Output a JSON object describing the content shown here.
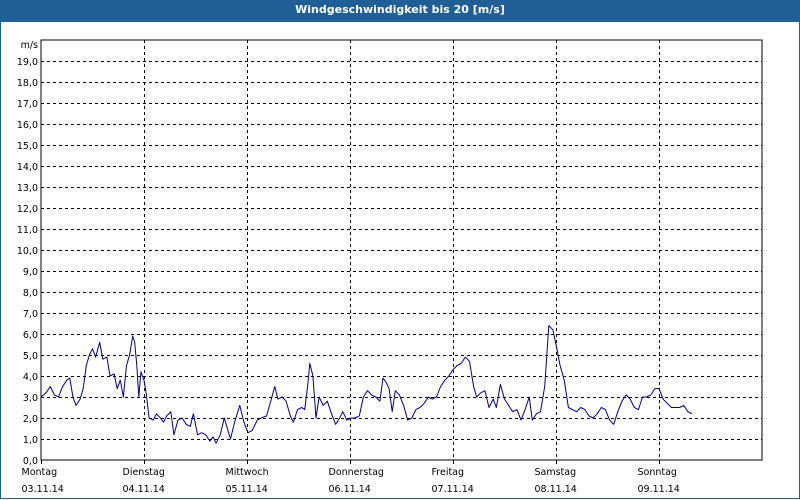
{
  "window": {
    "title": "Windgeschwindigkeit bis 20 [m/s]"
  },
  "chart_data": {
    "type": "line",
    "title": "Windgeschwindigkeit bis 20 [m/s]",
    "ylabel": "m/s",
    "ylim": [
      0,
      20
    ],
    "grid": true,
    "line_color": "#00008b",
    "grid_color": "#000000",
    "y_ticks": [
      "0,0",
      "1,0",
      "2,0",
      "3,0",
      "4,0",
      "5,0",
      "6,0",
      "7,0",
      "8,0",
      "9,0",
      "10,0",
      "11,0",
      "12,0",
      "13,0",
      "14,0",
      "15,0",
      "16,0",
      "17,0",
      "18,0",
      "19,0"
    ],
    "x_ticks": [
      {
        "day": "Montag",
        "date": "03.11.14"
      },
      {
        "day": "Dienstag",
        "date": "04.11.14"
      },
      {
        "day": "Mittwoch",
        "date": "05.11.14"
      },
      {
        "day": "Donnerstag",
        "date": "06.11.14"
      },
      {
        "day": "Freitag",
        "date": "07.11.14"
      },
      {
        "day": "Samstag",
        "date": "08.11.14"
      },
      {
        "day": "Sonntag",
        "date": "09.11.14"
      }
    ],
    "x_range_days": [
      0,
      7.0
    ],
    "series": [
      {
        "values": [
          [
            0.0,
            3.0
          ],
          [
            0.05,
            3.2
          ],
          [
            0.09,
            3.5
          ],
          [
            0.13,
            3.1
          ],
          [
            0.17,
            3.0
          ],
          [
            0.21,
            3.5
          ],
          [
            0.25,
            3.8
          ],
          [
            0.28,
            3.9
          ],
          [
            0.31,
            3.0
          ],
          [
            0.34,
            2.6
          ],
          [
            0.38,
            2.9
          ],
          [
            0.41,
            3.4
          ],
          [
            0.44,
            4.5
          ],
          [
            0.47,
            5.0
          ],
          [
            0.5,
            5.3
          ],
          [
            0.53,
            4.9
          ],
          [
            0.57,
            5.6
          ],
          [
            0.6,
            4.8
          ],
          [
            0.64,
            4.9
          ],
          [
            0.67,
            4.0
          ],
          [
            0.71,
            4.1
          ],
          [
            0.74,
            3.4
          ],
          [
            0.77,
            3.8
          ],
          [
            0.8,
            3.0
          ],
          [
            0.83,
            4.5
          ],
          [
            0.86,
            5.0
          ],
          [
            0.89,
            5.9
          ],
          [
            0.91,
            5.6
          ],
          [
            0.93,
            4.5
          ],
          [
            0.95,
            3.0
          ],
          [
            0.97,
            4.2
          ],
          [
            1.0,
            3.8
          ],
          [
            1.02,
            3.2
          ],
          [
            1.05,
            2.0
          ],
          [
            1.09,
            1.9
          ],
          [
            1.12,
            2.2
          ],
          [
            1.16,
            2.0
          ],
          [
            1.19,
            1.8
          ],
          [
            1.22,
            2.1
          ],
          [
            1.26,
            2.3
          ],
          [
            1.29,
            1.2
          ],
          [
            1.33,
            1.9
          ],
          [
            1.37,
            2.0
          ],
          [
            1.41,
            1.7
          ],
          [
            1.45,
            1.6
          ],
          [
            1.48,
            2.2
          ],
          [
            1.52,
            1.2
          ],
          [
            1.56,
            1.3
          ],
          [
            1.6,
            1.2
          ],
          [
            1.64,
            0.9
          ],
          [
            1.67,
            1.1
          ],
          [
            1.7,
            0.8
          ],
          [
            1.74,
            1.2
          ],
          [
            1.78,
            2.0
          ],
          [
            1.81,
            1.5
          ],
          [
            1.84,
            1.0
          ],
          [
            1.88,
            1.8
          ],
          [
            1.93,
            2.6
          ],
          [
            1.97,
            1.8
          ],
          [
            2.01,
            1.3
          ],
          [
            2.05,
            1.4
          ],
          [
            2.1,
            1.9
          ],
          [
            2.14,
            2.0
          ],
          [
            2.19,
            2.1
          ],
          [
            2.23,
            2.8
          ],
          [
            2.27,
            3.5
          ],
          [
            2.3,
            2.9
          ],
          [
            2.34,
            3.0
          ],
          [
            2.38,
            2.8
          ],
          [
            2.42,
            2.1
          ],
          [
            2.45,
            1.8
          ],
          [
            2.49,
            2.4
          ],
          [
            2.53,
            2.5
          ],
          [
            2.56,
            2.4
          ],
          [
            2.59,
            3.6
          ],
          [
            2.61,
            4.6
          ],
          [
            2.64,
            4.0
          ],
          [
            2.67,
            2.0
          ],
          [
            2.7,
            3.0
          ],
          [
            2.74,
            2.6
          ],
          [
            2.78,
            2.8
          ],
          [
            2.82,
            2.2
          ],
          [
            2.86,
            1.7
          ],
          [
            2.9,
            2.0
          ],
          [
            2.93,
            2.3
          ],
          [
            2.97,
            1.9
          ],
          [
            3.01,
            2.0
          ],
          [
            3.05,
            2.0
          ],
          [
            3.09,
            2.1
          ],
          [
            3.13,
            3.0
          ],
          [
            3.17,
            3.3
          ],
          [
            3.21,
            3.1
          ],
          [
            3.25,
            3.0
          ],
          [
            3.29,
            2.8
          ],
          [
            3.32,
            3.9
          ],
          [
            3.35,
            3.7
          ],
          [
            3.38,
            3.4
          ],
          [
            3.41,
            2.3
          ],
          [
            3.44,
            3.3
          ],
          [
            3.48,
            3.1
          ],
          [
            3.52,
            2.6
          ],
          [
            3.56,
            1.9
          ],
          [
            3.6,
            2.0
          ],
          [
            3.64,
            2.4
          ],
          [
            3.68,
            2.5
          ],
          [
            3.72,
            2.7
          ],
          [
            3.76,
            3.0
          ],
          [
            3.8,
            2.9
          ],
          [
            3.84,
            3.0
          ],
          [
            3.88,
            3.5
          ],
          [
            3.92,
            3.8
          ],
          [
            3.96,
            4.0
          ],
          [
            4.0,
            4.3
          ],
          [
            4.04,
            4.5
          ],
          [
            4.08,
            4.6
          ],
          [
            4.12,
            4.9
          ],
          [
            4.16,
            4.7
          ],
          [
            4.2,
            3.5
          ],
          [
            4.23,
            3.0
          ],
          [
            4.27,
            3.2
          ],
          [
            4.31,
            3.3
          ],
          [
            4.35,
            2.5
          ],
          [
            4.39,
            2.9
          ],
          [
            4.42,
            2.5
          ],
          [
            4.46,
            3.6
          ],
          [
            4.5,
            2.9
          ],
          [
            4.54,
            2.6
          ],
          [
            4.58,
            2.3
          ],
          [
            4.62,
            2.4
          ],
          [
            4.66,
            1.9
          ],
          [
            4.7,
            2.4
          ],
          [
            4.74,
            3.0
          ],
          [
            4.77,
            1.9
          ],
          [
            4.81,
            2.2
          ],
          [
            4.85,
            2.3
          ],
          [
            4.89,
            3.5
          ],
          [
            4.93,
            6.4
          ],
          [
            4.97,
            6.2
          ],
          [
            5.0,
            5.5
          ],
          [
            5.04,
            4.5
          ],
          [
            5.08,
            3.8
          ],
          [
            5.12,
            2.5
          ],
          [
            5.16,
            2.4
          ],
          [
            5.2,
            2.3
          ],
          [
            5.24,
            2.5
          ],
          [
            5.28,
            2.4
          ],
          [
            5.32,
            2.1
          ],
          [
            5.36,
            2.0
          ],
          [
            5.4,
            2.2
          ],
          [
            5.44,
            2.5
          ],
          [
            5.48,
            2.4
          ],
          [
            5.52,
            1.9
          ],
          [
            5.56,
            1.7
          ],
          [
            5.6,
            2.3
          ],
          [
            5.64,
            2.8
          ],
          [
            5.68,
            3.1
          ],
          [
            5.72,
            2.9
          ],
          [
            5.76,
            2.5
          ],
          [
            5.8,
            2.4
          ],
          [
            5.84,
            3.0
          ],
          [
            5.88,
            3.0
          ],
          [
            5.92,
            3.1
          ],
          [
            5.96,
            3.4
          ],
          [
            6.0,
            3.4
          ],
          [
            6.04,
            2.9
          ],
          [
            6.08,
            2.7
          ],
          [
            6.12,
            2.5
          ],
          [
            6.16,
            2.5
          ],
          [
            6.2,
            2.5
          ],
          [
            6.24,
            2.6
          ],
          [
            6.28,
            2.3
          ],
          [
            6.32,
            2.2
          ]
        ]
      }
    ]
  }
}
